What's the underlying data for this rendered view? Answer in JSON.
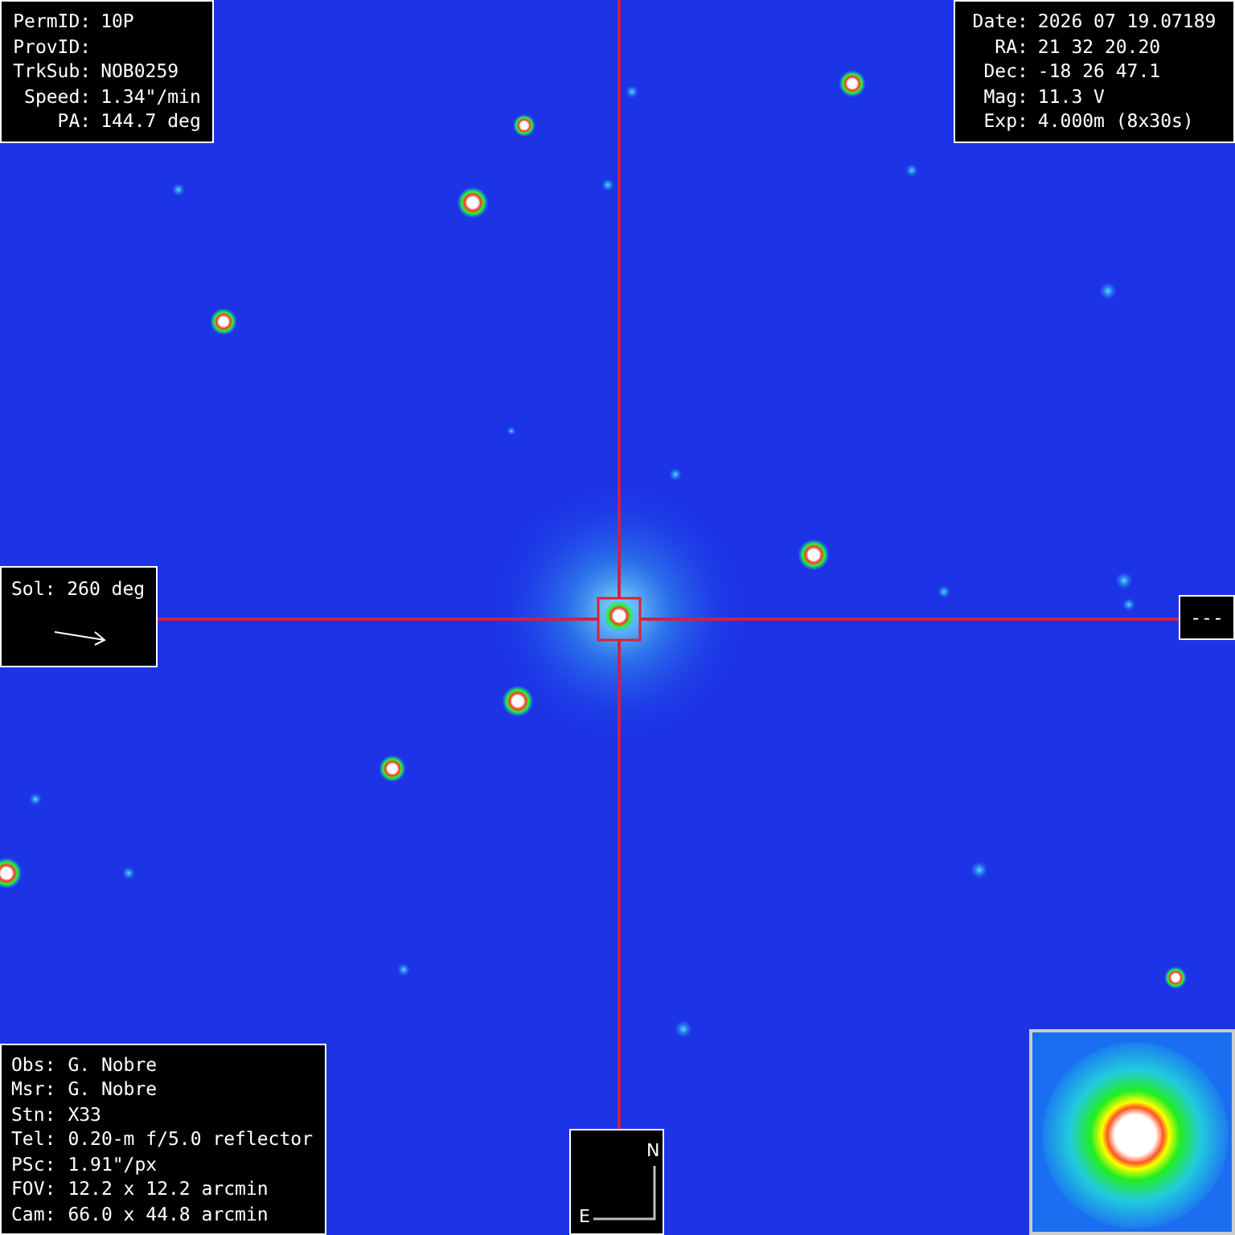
{
  "target_panel": {
    "lines": [
      {
        "label": "PermID:",
        "value": "10P"
      },
      {
        "label": "ProvID:"
      },
      {
        "label": "TrkSub:",
        "value": "NOB0259"
      },
      {
        "label": "Speed:",
        "value": "1.34\"/min"
      },
      {
        "label": "PA:",
        "value": "144.7 deg"
      }
    ]
  },
  "observation_panel": {
    "lines": [
      {
        "label": "Date:",
        "value": "2026 07 19.07189"
      },
      {
        "label": "RA:",
        "value": "21 32 20.20"
      },
      {
        "label": "Dec:",
        "value": "-18 26 47.1"
      },
      {
        "label": "Mag:",
        "value": "11.3 V"
      },
      {
        "label": "Exp:",
        "value": "4.000m (8x30s)"
      }
    ]
  },
  "sun_panel": {
    "label": "Sol:",
    "value": "260 deg"
  },
  "right_marker": {
    "text": "---"
  },
  "setup_panel": {
    "lines": [
      {
        "label": "Obs:",
        "value": "G. Nobre"
      },
      {
        "label": "Msr:",
        "value": "G. Nobre"
      },
      {
        "label": "Stn:",
        "value": "X33"
      },
      {
        "label": "Tel:",
        "value": "0.20-m f/5.0 reflector"
      },
      {
        "label": "PSc:",
        "value": "1.91\"/px"
      },
      {
        "label": "FOV:",
        "value": "12.2 x 12.2 arcmin"
      },
      {
        "label": "Cam:",
        "value": "66.0 x 44.8 arcmin"
      }
    ]
  },
  "compass": {
    "north": "N",
    "east": "E"
  }
}
